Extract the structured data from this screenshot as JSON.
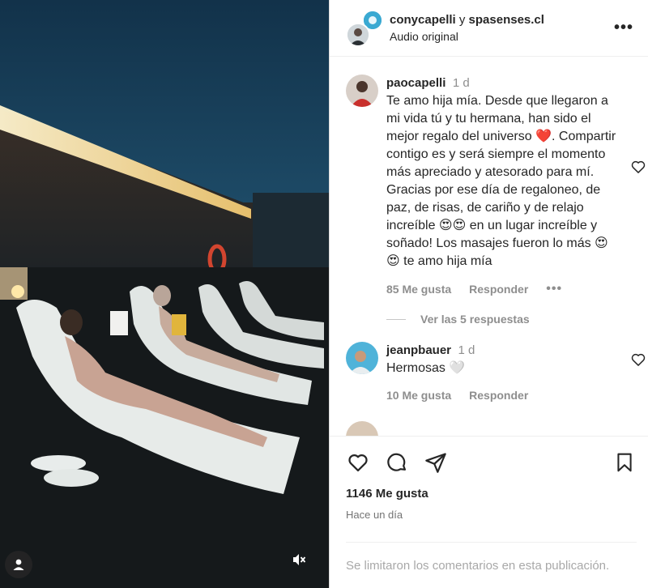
{
  "header": {
    "user_primary": "conycapelli",
    "connector": "y",
    "user_secondary": "spasenses.cl",
    "audio": "Audio original"
  },
  "comments": [
    {
      "user": "paocapelli",
      "time": "1 d",
      "text": "Te amo hija mía. Desde que llegaron a mi vida tú y tu hermana, han sido el mejor regalo del universo ❤️. Compartir contigo es y será siempre el momento más apreciado y atesorado para mí. Gracias por ese día de regaloneo, de paz, de risas, de cariño y de relajo increíble 😍😍 en un lugar increíble y soñado! Los masajes fueron lo más 😍😍 te amo hija mía",
      "likes": "85 Me gusta",
      "reply": "Responder",
      "view_replies": "Ver las 5 respuestas"
    },
    {
      "user": "jeanpbauer",
      "time": "1 d",
      "text": "Hermosas 🤍",
      "likes": "10 Me gusta",
      "reply": "Responder"
    }
  ],
  "footer": {
    "likes": "1146 Me gusta",
    "date": "Hace un día",
    "comments_limited": "Se limitaron los comentarios en esta publicación."
  },
  "colors": {
    "text": "#262626",
    "muted": "#8e8e8e",
    "border": "#dbdbdb"
  }
}
